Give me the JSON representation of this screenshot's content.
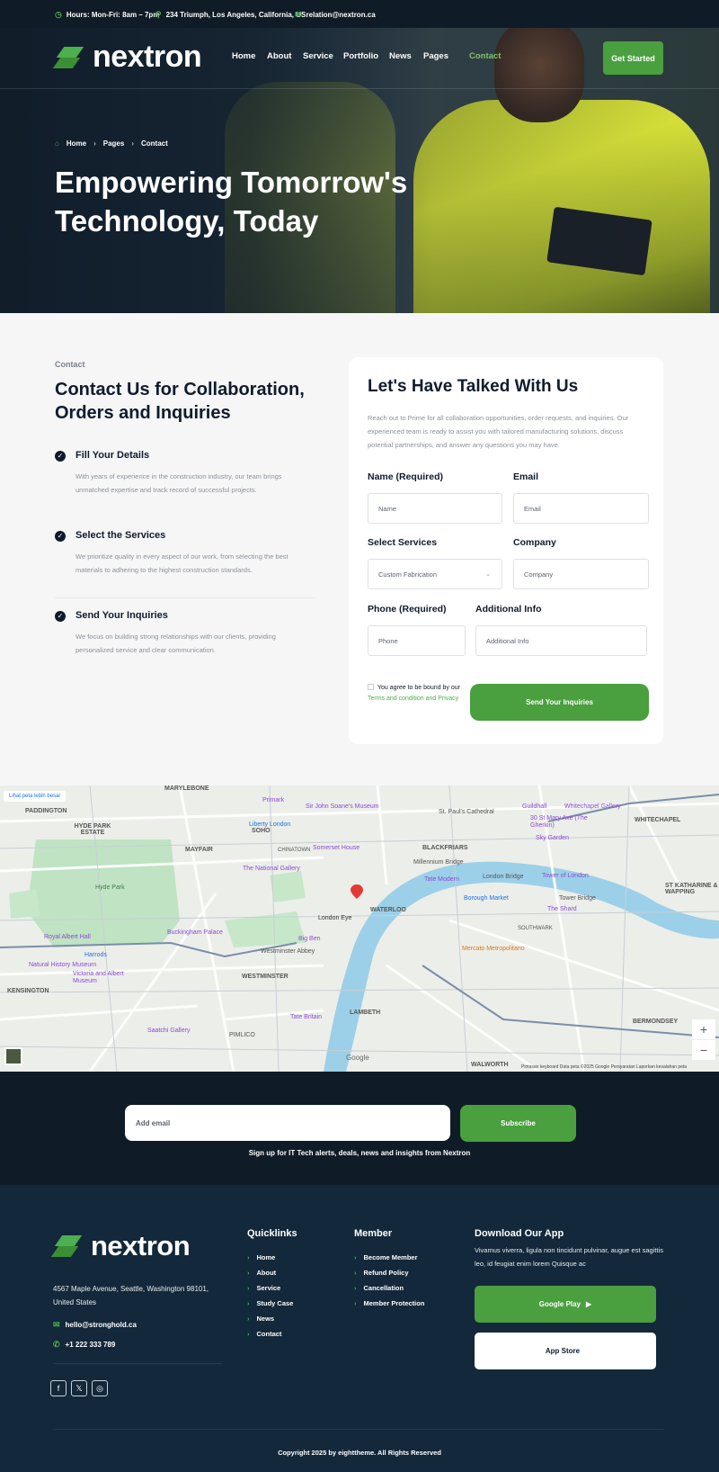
{
  "topbar": {
    "hours": "Hours: Mon-Fri: 8am – 7pm",
    "address": "234 Triumph, Los Angeles, California, US",
    "email": "relation@nextron.ca"
  },
  "brand": {
    "name": "nextron",
    "accent": "#4caf50",
    "dark": "#0f1b26"
  },
  "nav": {
    "items": [
      "Home",
      "About",
      "Service",
      "Portfolio",
      "News",
      "Pages",
      "Contact"
    ],
    "active": "Contact",
    "cta": "Get Started"
  },
  "hero": {
    "breadcrumb": [
      "Home",
      "Pages",
      "Contact"
    ],
    "title": "Empowering Tomorrow's Technology, Today"
  },
  "contact": {
    "label": "Contact",
    "heading": "Contact Us for Collaboration, Orders and Inquiries",
    "steps": [
      {
        "title": "Fill Your Details",
        "desc": "With years of experience in the construction industry, our team brings unmatched expertise and track record of successful projects."
      },
      {
        "title": "Select the Services",
        "desc": "We prioritize quality in every aspect of our work, from selecting the best materials to adhering to the highest construction standards."
      },
      {
        "title": "Send Your Inquiries",
        "desc": "We focus on building strong relationships with our clients, providing personalized service and clear communication."
      }
    ]
  },
  "form": {
    "heading": "Let's Have Talked With Us",
    "intro": "Reach out to Prime for all collaboration opportunities, order requests, and inquiries. Our experienced team is ready to assist you with tailored manufacturing solutions, discuss potential partnerships, and answer any questions you may have.",
    "name_label": "Name (Required)",
    "name_placeholder": "Name",
    "email_label": "Email",
    "email_placeholder": "Email",
    "services_label": "Select Services",
    "services_value": "Custom Fabrication",
    "company_label": "Company",
    "company_placeholder": "Company",
    "phone_label": "Phone (Required)",
    "phone_placeholder": "Phone",
    "info_label": "Additional Info",
    "info_placeholder": "Additional Info",
    "agree_text": "You agree to be bound by our",
    "agree_link": "Terms and condition and Privacy",
    "submit": "Send Your Inquiries"
  },
  "map": {
    "link": "Lihat peta lebih besar",
    "labels": [
      "MARYLEBONE",
      "PADDINGTON",
      "HYDE PARK ESTATE",
      "MAYFAIR",
      "SOHO",
      "CHINATOWN",
      "BLACKFRIARS",
      "WHITECHAPEL",
      "Hyde Park",
      "WATERLOO",
      "WESTMINSTER",
      "LAMBETH",
      "KENSINGTON",
      "PIMLICO",
      "SOUTHWARK",
      "BERMONDSEY",
      "WALWORTH",
      "ST KATHARINE & WAPPING",
      "London Eye"
    ],
    "places": [
      "Primark",
      "Sir John Soane's Museum",
      "Liberty London",
      "Somerset House",
      "The National Gallery",
      "Millennium Bridge",
      "Tate Modern",
      "London Bridge",
      "Tower of London",
      "Borough Market",
      "The Shard",
      "Tower Bridge",
      "Buckingham Palace",
      "Big Ben",
      "Westminster Abbey",
      "Royal Albert Hall",
      "Harrods",
      "Natural History Museum",
      "Victoria and Albert Museum",
      "Tate Britain",
      "Saatchi Gallery",
      "Mercato Metropolitano",
      "Guildhall",
      "Whitechapel Gallery",
      "30 St Mary Axe (The Gherkin)",
      "Sky Garden",
      "St. Paul's Cathedral"
    ],
    "footer": "Pintasan keyboard   Data peta ©2025 Google   Persyaratan   Laporkan kesalahan peta",
    "google": "Google",
    "zoom_in": "+",
    "zoom_out": "−"
  },
  "subscribe": {
    "placeholder": "Add email",
    "button": "Subscribe",
    "note": "Sign up for IT Tech alerts, deals, news and insights from Nextron"
  },
  "footer": {
    "address": "4567 Maple Avenue, Seattle, Washington 98101, United States",
    "email": "hello@stronghold.ca",
    "phone": "+1 222 333 789",
    "quicklinks_title": "Quicklinks",
    "quicklinks": [
      "Home",
      "About",
      "Service",
      "Study Case",
      "News",
      "Contact"
    ],
    "member_title": "Member",
    "member": [
      "Become Member",
      "Refund Policy",
      "Cancellation",
      "Member Protection"
    ],
    "app_title": "Download Our App",
    "app_text": "Vivamus viverra, ligula non tincidunt pulvinar, augue est sagittis leo, id feugiat enim lorem Quisque ac",
    "google_play": "Google Play",
    "app_store": "App Store",
    "copyright": "Copyright 2025 by eighttheme. All Rights Reserved"
  }
}
